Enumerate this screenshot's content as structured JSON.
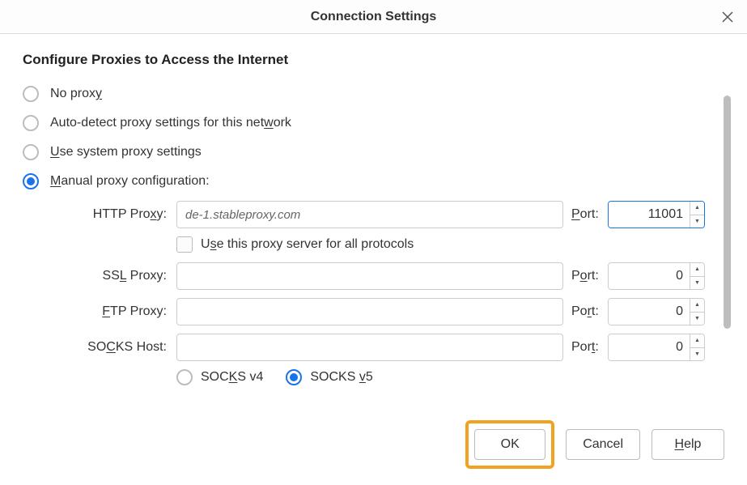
{
  "titlebar": {
    "title": "Connection Settings"
  },
  "section_title": "Configure Proxies to Access the Internet",
  "options": {
    "no_proxy": "No proxy",
    "autodetect": "Auto-detect proxy settings for this network",
    "system": "Use system proxy settings",
    "manual": "Manual proxy configuration:"
  },
  "proxies": {
    "http": {
      "label": "HTTP Proxy:",
      "host": "de-1.stableproxy.com",
      "port_label": "Port:",
      "port": "11001"
    },
    "ssl": {
      "label": "SSL Proxy:",
      "host": "",
      "port_label": "Port:",
      "port": "0"
    },
    "ftp": {
      "label": "FTP Proxy:",
      "host": "",
      "port_label": "Port:",
      "port": "0"
    },
    "socks": {
      "label": "SOCKS Host:",
      "host": "",
      "port_label": "Port:",
      "port": "0"
    }
  },
  "use_for_all": "Use this proxy server for all protocols",
  "socks_versions": {
    "v4": "SOCKS v4",
    "v5": "SOCKS v5"
  },
  "buttons": {
    "ok": "OK",
    "cancel": "Cancel",
    "help": "Help"
  }
}
